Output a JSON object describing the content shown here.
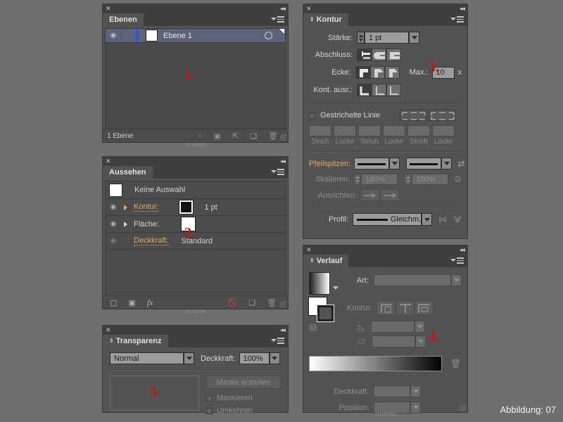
{
  "caption": "Abbildung: 07",
  "colors": {
    "marker": "#cc1111",
    "orange": "#e3a765",
    "panel_bg": "#535353",
    "canvas_bg": "#6e6e6e"
  },
  "panels": {
    "layers": {
      "tab": "Ebenen",
      "marker": "1.",
      "layer_name": "Ebene 1",
      "footer_text": "1 Ebene",
      "icons": [
        "eye-icon",
        "lock-column",
        "layer-color-bar",
        "thumbnail",
        "target-circle-icon",
        "selection-indicator"
      ],
      "footer_icons": [
        "locate-object-icon",
        "collect-in-new-layer-icon",
        "create-sublayer-icon",
        "new-layer-icon",
        "delete-layer-icon"
      ]
    },
    "appearance": {
      "tab": "Aussehen",
      "marker": "2.",
      "rows": [
        {
          "name": "Keine Auswahl",
          "value": ""
        },
        {
          "name": "Kontur:",
          "value": "1 pt"
        },
        {
          "name": "Fläche:",
          "value": ""
        },
        {
          "name": "Deckkraft:",
          "value": "Standard"
        }
      ],
      "footer_icons": [
        "add-stroke-icon",
        "add-fill-icon",
        "fx-icon",
        "clear-appearance-icon",
        "duplicate-item-icon",
        "delete-item-icon"
      ]
    },
    "stroke": {
      "tab": "Kontur",
      "marker": "3.",
      "weight_label": "Stärke:",
      "weight_value": "1 pt",
      "cap_label": "Abschluss:",
      "corner_label": "Ecke:",
      "limit_label": "Max.:",
      "limit_value": "10",
      "limit_unit": "x",
      "align_label": "Kont. ausr.:",
      "dashed_label": "Gestrichelte Linie",
      "dash_fields": [
        "Strich",
        "Lücke",
        "Strich",
        "Lücke",
        "Strich",
        "Lücke"
      ],
      "arrow_label": "Pfeilspitzen:",
      "scale_label": "Skalieren:",
      "scale_values": [
        "100%",
        "100%"
      ],
      "align_arrow_label": "Ausrichten:",
      "profile_label": "Profil:",
      "profile_value": "Gleichm."
    },
    "gradient": {
      "tab": "Verlauf",
      "marker": "4.",
      "type_label": "Art:",
      "type_value": "",
      "stroke_label": "Kontur:",
      "angle_value": "",
      "aspect_value": "",
      "opacity_label": "Deckkraft:",
      "opacity_value": "",
      "position_label": "Position:",
      "position_value": "",
      "icons": [
        "gradient-swatch",
        "fill-stroke-swatch",
        "gradient-mode-icon",
        "angle-icon",
        "aspect-ratio-icon",
        "delete-stop-icon"
      ]
    },
    "transparency": {
      "tab": "Transparenz",
      "marker": "5.",
      "blend_mode": "Normal",
      "opacity_label": "Deckkraft:",
      "opacity_value": "100%",
      "make_mask_label": "Maske erstellen",
      "clip_label": "Maskieren",
      "invert_label": "Umkehren"
    }
  }
}
